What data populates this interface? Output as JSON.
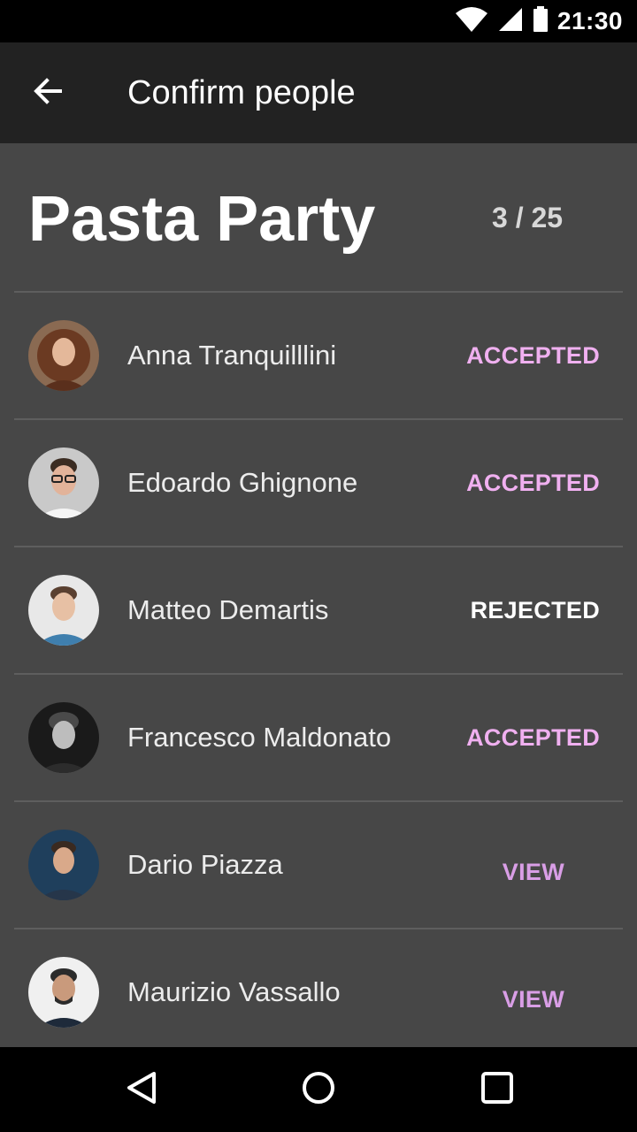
{
  "status_bar": {
    "time": "21:30"
  },
  "app_bar": {
    "title": "Confirm people",
    "back_icon": "arrow-back-icon"
  },
  "event": {
    "name": "Pasta Party",
    "count": "3 / 25"
  },
  "people": [
    {
      "name": "Anna Tranquilllini",
      "status": "ACCEPTED",
      "status_type": "accepted"
    },
    {
      "name": "Edoardo Ghignone",
      "status": "ACCEPTED",
      "status_type": "accepted"
    },
    {
      "name": "Matteo Demartis",
      "status": "REJECTED",
      "status_type": "rejected"
    },
    {
      "name": "Francesco Maldonato",
      "status": "ACCEPTED",
      "status_type": "accepted"
    },
    {
      "name": "Dario Piazza",
      "status": "VIEW",
      "status_type": "view"
    },
    {
      "name": "Maurizio Vassallo",
      "status": "VIEW",
      "status_type": "view"
    }
  ],
  "colors": {
    "accepted": "#f0b0f0",
    "rejected": "#ffffff",
    "view": "#d99ee6",
    "app_bar": "#222222",
    "content_bg": "#474747"
  },
  "nav_icons": [
    "back-triangle-icon",
    "home-circle-icon",
    "recents-square-icon"
  ]
}
